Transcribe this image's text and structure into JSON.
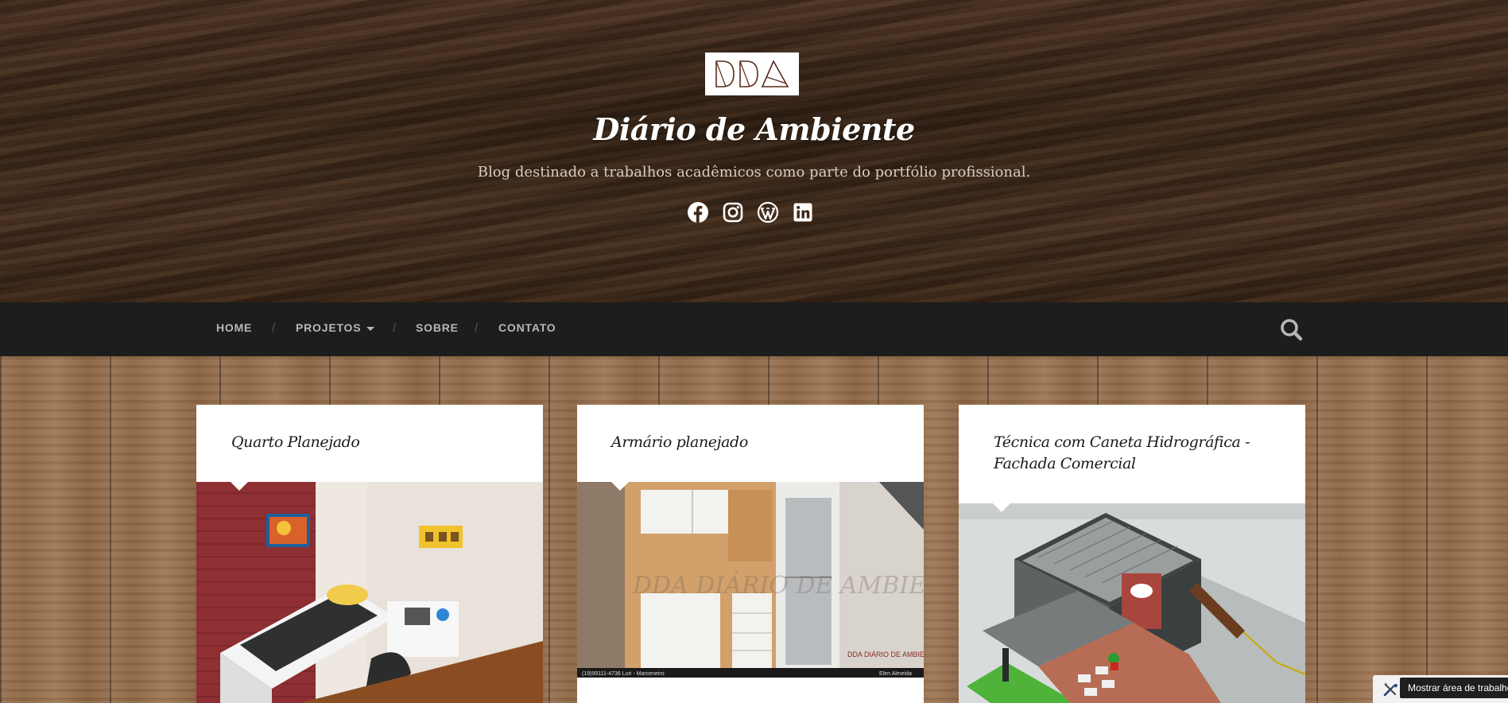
{
  "header": {
    "logo_text": "DDA",
    "site_title": "Diário de Ambiente",
    "tagline": "Blog destinado a trabalhos acadêmicos como parte do portfólio profissional.",
    "social": [
      "facebook-icon",
      "instagram-icon",
      "wordpress-icon",
      "linkedin-icon"
    ]
  },
  "nav": {
    "items": [
      {
        "label": "HOME"
      },
      {
        "label": "PROJETOS",
        "has_dropdown": true
      },
      {
        "label": "SOBRE"
      },
      {
        "label": "CONTATO"
      }
    ],
    "separator": "/"
  },
  "posts": [
    {
      "title": "Quarto Planejado"
    },
    {
      "title": "Armário planejado",
      "image_watermark": "DDA DIÁRIO DE AMBIENTE",
      "image_caption": "DDA DIÁRIO DE AMBIENTE",
      "image_footer_left": "(19)99111-4736 Luri - Marceneiro",
      "image_footer_right": "Elen Almeida"
    },
    {
      "title": "Técnica com Caneta Hidrográfica - Fachada Comercial"
    }
  ],
  "corner": {
    "tooltip": "Mostrar área de trabalho"
  },
  "colors": {
    "nav_bg": "#1d1d1d",
    "nav_text": "#b8b8b8",
    "logo_stroke": "#5b2c1c"
  }
}
